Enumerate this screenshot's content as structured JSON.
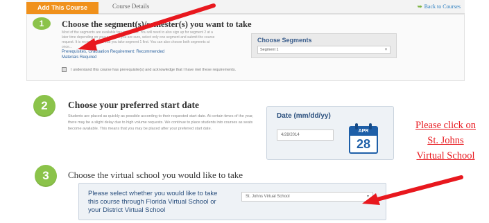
{
  "tabs": {
    "add_course": "Add This Course",
    "course_details": "Course Details",
    "back_to_courses": "Back to Courses"
  },
  "section1": {
    "number": "1",
    "title": "Choose the segment(s)/semester(s) you want to take",
    "description": "Most of the segments are available for you to take. You will need to also sign up for segment 2 at a later time depending on your needs. If you are sure, select only one segment and submit the course request. It is recommended that you take segment 1 first. You can also choose both segments at once...",
    "choose_segments_label": "Choose Segments",
    "segment_selected": "Segment 1",
    "links": [
      "Prerequisites, Graduation Requirement: Recommended",
      "Materials Required"
    ],
    "checkbox_text": "I understand this course has prerequisite(s) and acknowledge that I have met these requirements."
  },
  "section2": {
    "number": "2",
    "title": "Choose your preferred start date",
    "description": "Students are placed as quickly as possible according to their requested start date. At certain times of the year, there may be a slight delay due to high volume requests. We continue to place students into courses as seats become available. This means that you may be placed after your preferred start date.",
    "date_label": "Date (mm/dd/yy)",
    "date_value": "4/28/2014",
    "calendar": {
      "month": "APR",
      "day": "28"
    }
  },
  "note": {
    "lines": [
      "Please click on",
      "St. Johns",
      "Virtual School"
    ]
  },
  "section3": {
    "number": "3",
    "title": "Choose the virtual school you would like to take",
    "question": "Please select whether you would like to take this course through Florida Virtual School or your District Virtual School",
    "school_selected": "St. Johns Virtual School"
  },
  "colors": {
    "accent_orange": "#f0911c",
    "step_green": "#8bc34a",
    "label_blue": "#2a4f7d",
    "annotation_red": "#e8181e"
  }
}
